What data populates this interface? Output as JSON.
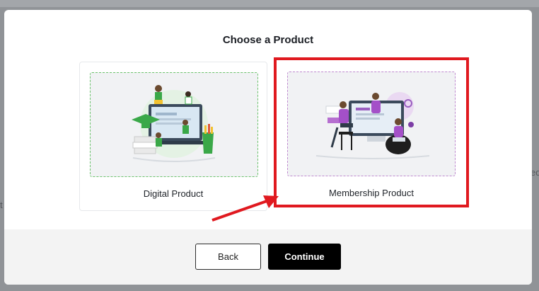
{
  "modal": {
    "title": "Choose a Product"
  },
  "cards": [
    {
      "label": "Digital Product",
      "accent": "#6cc36c"
    },
    {
      "label": "Membership Product",
      "accent": "#c08ad0"
    }
  ],
  "footer": {
    "back_label": "Back",
    "continue_label": "Continue"
  },
  "annotation": {
    "highlight_color": "#e0191f"
  },
  "background_app": {
    "fragments": [
      "ed",
      "t"
    ]
  }
}
